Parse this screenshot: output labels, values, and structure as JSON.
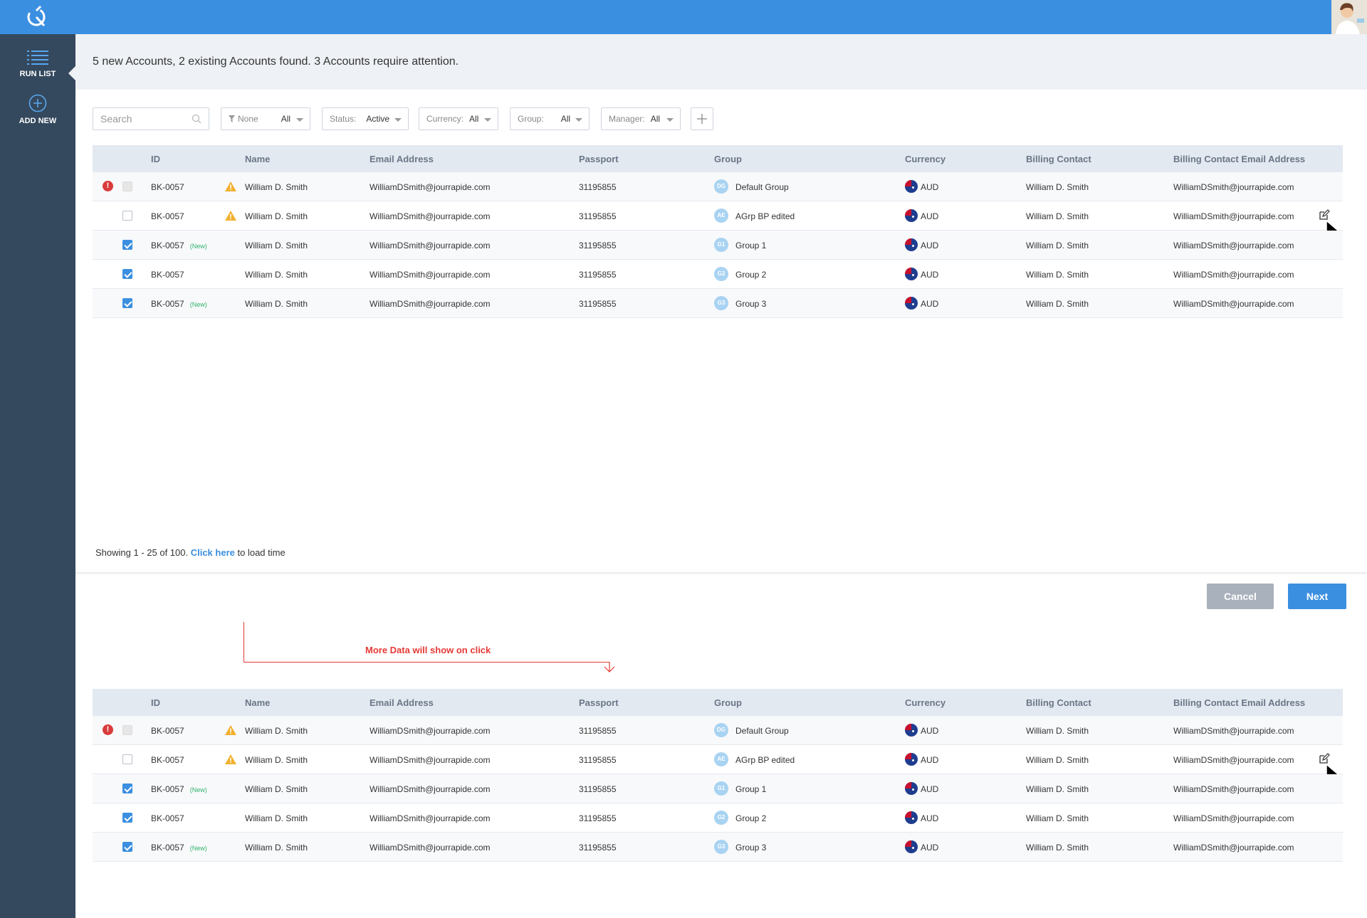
{
  "sidebar": {
    "items": [
      {
        "label": "RUN LIST",
        "icon": "list-icon"
      },
      {
        "label": "ADD NEW",
        "icon": "plus-circle-icon"
      }
    ]
  },
  "banner": {
    "text": "5 new Accounts, 2 existing Accounts found. 3 Accounts require attention."
  },
  "filters": {
    "search_placeholder": "Search",
    "filter": {
      "label": "None",
      "value": "All"
    },
    "status": {
      "label": "Status:",
      "value": "Active"
    },
    "currency": {
      "label": "Currency:",
      "value": "All"
    },
    "group": {
      "label": "Group:",
      "value": "All"
    },
    "manager": {
      "label": "Manager:",
      "value": "All"
    }
  },
  "table": {
    "columns": [
      "ID",
      "Name",
      "Email Address",
      "Passport",
      "Group",
      "Currency",
      "Billing Contact",
      "Billing Contact Email Address"
    ],
    "rows": [
      {
        "id": "BK-0057",
        "new": "",
        "name": "William D. Smith",
        "email": "WilliamDSmith@jourrapide.com",
        "passport": "31195855",
        "group_badge": "DG",
        "group": "Default Group",
        "currency": "AUD",
        "contact": "William D. Smith",
        "contact_email": "WilliamDSmith@jourrapide.com"
      },
      {
        "id": "BK-0057",
        "new": "",
        "name": "William D. Smith",
        "email": "WilliamDSmith@jourrapide.com",
        "passport": "31195855",
        "group_badge": "AE",
        "group": "AGrp BP edited",
        "currency": "AUD",
        "contact": "William D. Smith",
        "contact_email": "WilliamDSmith@jourrapide.com"
      },
      {
        "id": "BK-0057",
        "new": "(New)",
        "name": "William D. Smith",
        "email": "WilliamDSmith@jourrapide.com",
        "passport": "31195855",
        "group_badge": "G1",
        "group": "Group 1",
        "currency": "AUD",
        "contact": "William D. Smith",
        "contact_email": "WilliamDSmith@jourrapide.com"
      },
      {
        "id": "BK-0057",
        "new": "",
        "name": "William D. Smith",
        "email": "WilliamDSmith@jourrapide.com",
        "passport": "31195855",
        "group_badge": "G2",
        "group": "Group 2",
        "currency": "AUD",
        "contact": "William D. Smith",
        "contact_email": "WilliamDSmith@jourrapide.com"
      },
      {
        "id": "BK-0057",
        "new": "(New)",
        "name": "William D. Smith",
        "email": "WilliamDSmith@jourrapide.com",
        "passport": "31195855",
        "group_badge": "G3",
        "group": "Group 3",
        "currency": "AUD",
        "contact": "William D. Smith",
        "contact_email": "WilliamDSmith@jourrapide.com"
      }
    ]
  },
  "footer": {
    "showing": "Showing 1 - 25 of 100.",
    "link": "Click here",
    "after": "to load time"
  },
  "buttons": {
    "cancel": "Cancel",
    "next": "Next"
  },
  "annotation": {
    "text": "More Data will show on click"
  },
  "colors": {
    "accent": "#3b8fe0",
    "sidebar": "#34495e",
    "error": "#d93b3b",
    "warning": "#f2b02f",
    "new_tag": "#2fb36b",
    "annotation": "#e53935"
  }
}
